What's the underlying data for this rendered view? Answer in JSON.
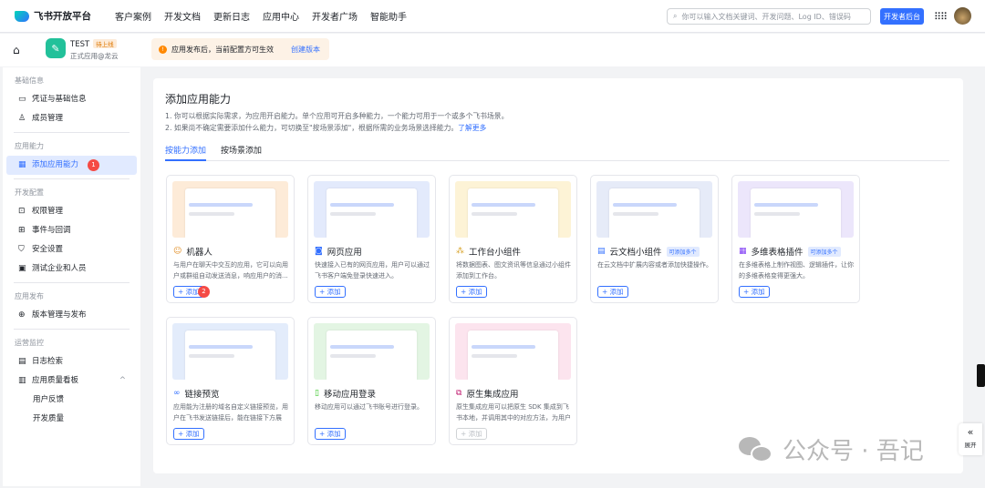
{
  "header": {
    "logo": "飞书开放平台",
    "nav": [
      "客户案例",
      "开发文档",
      "更新日志",
      "应用中心",
      "开发者广场",
      "智能助手"
    ],
    "search_placeholder": "你可以输入文档关键词、开发问题、Log ID、错误码",
    "dev_console": "开发者后台"
  },
  "app": {
    "name": "TEST",
    "status": "待上线",
    "subtitle": "正式应用@龙云"
  },
  "notice": {
    "text": "应用发布后，当前配置方可生效",
    "link": "创建版本",
    "icon": "!"
  },
  "sidebar": {
    "groups": [
      {
        "title": "基础信息",
        "items": [
          {
            "label": "凭证与基础信息",
            "icon": "▭"
          },
          {
            "label": "成员管理",
            "icon": "♙"
          }
        ]
      },
      {
        "title": "应用能力",
        "items": [
          {
            "label": "添加应用能力",
            "icon": "▦",
            "badge": "1",
            "active": true
          }
        ]
      },
      {
        "title": "开发配置",
        "items": [
          {
            "label": "权限管理",
            "icon": "⊡"
          },
          {
            "label": "事件与回调",
            "icon": "⊞"
          },
          {
            "label": "安全设置",
            "icon": "⛉"
          },
          {
            "label": "测试企业和人员",
            "icon": "▣"
          }
        ]
      },
      {
        "title": "应用发布",
        "items": [
          {
            "label": "版本管理与发布",
            "icon": "⊕"
          }
        ]
      },
      {
        "title": "运营监控",
        "items": [
          {
            "label": "日志检索",
            "icon": "▤"
          },
          {
            "label": "应用质量看板",
            "icon": "▥",
            "chevron": "^"
          },
          {
            "label": "用户反馈",
            "child": true
          },
          {
            "label": "开发质量",
            "child": true
          }
        ]
      }
    ]
  },
  "main": {
    "title": "添加应用能力",
    "desc1": "1. 你可以根据实际需求，为应用开启能力。单个应用可开启多种能力，一个能力可用于一个或多个飞书场景。",
    "desc2": "2. 如果尚不确定需要添加什么能力，可切换至\"按场景添加\"，根据所需的业务场景选择能力。",
    "learn_more": "了解更多",
    "tabs": [
      "按能力添加",
      "按场景添加"
    ],
    "add_label": "+ 添加",
    "multi_label": "可添加多个",
    "cards": [
      {
        "title": "机器人",
        "icon": "☺",
        "color": "#e08a1e",
        "bg": "#fdebd8",
        "desc": "与用户在聊天中交互的应用，它可以向用户或群组自动发送消息，响应用户的消...",
        "badge": "2"
      },
      {
        "title": "网页应用",
        "icon": "◙",
        "color": "#3370ff",
        "bg": "#e3eafc",
        "desc": "快速接入已有的网页应用，用户可以通过飞书客户端免登录快速进入。"
      },
      {
        "title": "工作台小组件",
        "icon": "⁂",
        "color": "#d69e1e",
        "bg": "#fdf3d6",
        "desc": "将数据图表、图文资讯等信息通过小组件添加到工作台。"
      },
      {
        "title": "云文档小组件",
        "icon": "▤",
        "color": "#3370ff",
        "bg": "#e6ebf8",
        "desc": "在云文档中扩展内容或者添加快捷操作。",
        "multi": true
      },
      {
        "title": "多维表格插件",
        "icon": "▦",
        "color": "#7f3bf5",
        "bg": "#ece6fb",
        "desc": "在多维表格上制作视图、逻辑插件，让你的多维表格变得更强大。",
        "multi": true
      },
      {
        "title": "链接预览",
        "icon": "∞",
        "color": "#3370ff",
        "bg": "#e3ecfb",
        "desc": "应用能为注册的域名自定义链接预览，用户在飞书发送链接后，能在链接下方展示..."
      },
      {
        "title": "移动应用登录",
        "icon": "▯",
        "color": "#34c724",
        "bg": "#e3f5e3",
        "desc": "移动应用可以通过飞书账号进行登录。"
      },
      {
        "title": "原生集成应用",
        "icon": "⧉",
        "color": "#c0186e",
        "bg": "#fce4ee",
        "desc": "原生集成应用可以把原生 SDK 集成到飞书本地，并调用其中的对应方法，为用户提...",
        "disabled": true
      }
    ]
  },
  "watermark": "公众号 · 吾记",
  "expand_label": "展开",
  "expand_icon": "«"
}
